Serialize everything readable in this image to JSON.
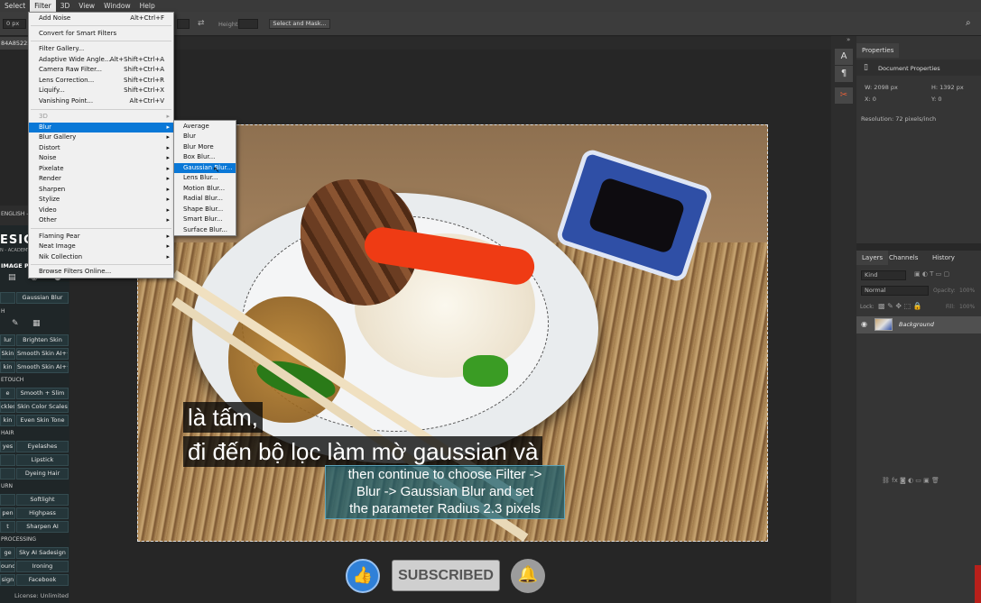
{
  "menubar": [
    "Select",
    "Filter",
    "3D",
    "View",
    "Window",
    "Help"
  ],
  "optbar": {
    "px": "0 px",
    "height_label": "Height:",
    "select_mask": "Select and Mask..."
  },
  "doc_tab": "84A85225",
  "filter_menu": {
    "items": [
      {
        "label": "Add Noise",
        "shortcut": "Alt+Ctrl+F"
      },
      {
        "label": "Convert for Smart Filters"
      },
      {
        "label": "Filter Gallery..."
      },
      {
        "label": "Adaptive Wide Angle...",
        "shortcut": "Alt+Shift+Ctrl+A"
      },
      {
        "label": "Camera Raw Filter...",
        "shortcut": "Shift+Ctrl+A"
      },
      {
        "label": "Lens Correction...",
        "shortcut": "Shift+Ctrl+R"
      },
      {
        "label": "Liquify...",
        "shortcut": "Shift+Ctrl+X"
      },
      {
        "label": "Vanishing Point...",
        "shortcut": "Alt+Ctrl+V"
      },
      {
        "label": "3D"
      },
      {
        "label": "Blur"
      },
      {
        "label": "Blur Gallery"
      },
      {
        "label": "Distort"
      },
      {
        "label": "Noise"
      },
      {
        "label": "Pixelate"
      },
      {
        "label": "Render"
      },
      {
        "label": "Sharpen"
      },
      {
        "label": "Stylize"
      },
      {
        "label": "Video"
      },
      {
        "label": "Other"
      },
      {
        "label": "Flaming Pear"
      },
      {
        "label": "Neat Image"
      },
      {
        "label": "Nik Collection"
      },
      {
        "label": "Browse Filters Online..."
      }
    ]
  },
  "blur_menu": [
    "Average",
    "Blur",
    "Blur More",
    "Box Blur...",
    "Gaussian Blur...",
    "Lens Blur...",
    "Motion Blur...",
    "Radial Blur...",
    "Shape Blur...",
    "Smart Blur...",
    "Surface Blur..."
  ],
  "properties": {
    "tab": "Properties",
    "doc": "Document Properties",
    "w": "W:  2098 px",
    "h": "H:  1392 px",
    "x": "X:  0",
    "y": "Y:  0",
    "resolution": "Resolution: 72 pixels/inch"
  },
  "layers": {
    "tabs": [
      "Layers",
      "Channels",
      "History"
    ],
    "kind": "Kind",
    "blend": "Normal",
    "opacity": "Opacity:",
    "opacity_val": "100%",
    "lock": "Lock:",
    "fill": "Fill:",
    "fill_val": "100%",
    "layer_name": "Background"
  },
  "plugin": {
    "lang": "ENGLISH - 3.",
    "brand": "ESIGN",
    "brand_sub": "N - ACADEMY",
    "section_image": "IMAGE P",
    "h_head": "H",
    "retouch": "ETOUCH",
    "hair": "HAIR",
    "burn": "URN",
    "processing": "PROCESSING",
    "buttons": [
      [
        "",
        "Gaussian Blur"
      ],
      [
        "lur",
        "Brighten Skin"
      ],
      [
        "Skin",
        "Smooth Skin AI++"
      ],
      [
        "kin",
        "Smooth Skin AI+++"
      ],
      [
        "e",
        "Smooth + Slim"
      ],
      [
        "ckles",
        "Skin Color Scales"
      ],
      [
        "kin",
        "Even Skin Tone"
      ],
      [
        "yes",
        "Eyelashes"
      ],
      [
        "",
        "Lipstick"
      ],
      [
        "",
        "Dyeing Hair"
      ],
      [
        "",
        "Softlight"
      ],
      [
        "pen",
        "Highpass"
      ],
      [
        "t",
        "Sharpen AI"
      ],
      [
        "ge",
        "Sky AI Sadesign"
      ],
      [
        "ound",
        "Ironing"
      ],
      [
        "sign",
        "Facebook"
      ]
    ],
    "license": "License: Unlimited"
  },
  "subtitles": {
    "line1": "là tấm,",
    "line2": "đi đến bộ lọc làm mờ gaussian và",
    "caption": [
      "then continue to choose Filter ->",
      "Blur -> Gaussian Blur and set",
      "the parameter Radius 2.3 pixels"
    ]
  },
  "subscribe": {
    "label": "SUBSCRIBED"
  }
}
